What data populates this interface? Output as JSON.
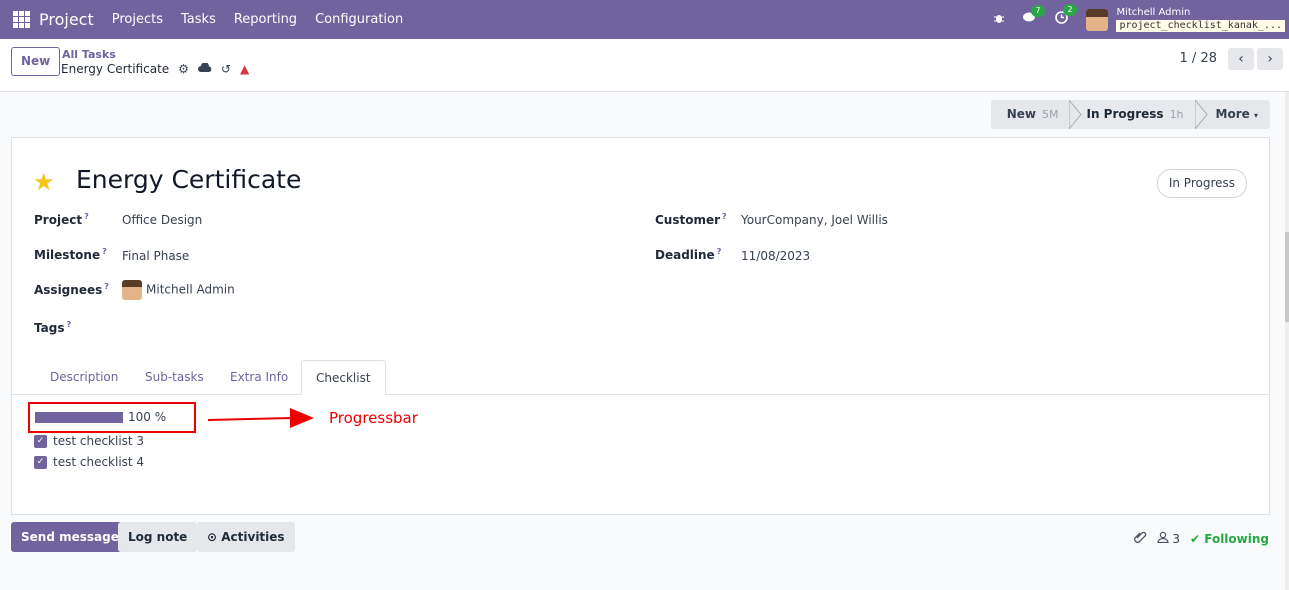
{
  "topnav": {
    "brand": "Project",
    "menu": [
      "Projects",
      "Tasks",
      "Reporting",
      "Configuration"
    ],
    "messages_badge": "7",
    "activities_badge": "2",
    "user_name": "Mitchell Admin",
    "db_name": "project_checklist_kanak_..."
  },
  "control": {
    "new_label": "New",
    "breadcrumb_parent": "All Tasks",
    "breadcrumb_current": "Energy Certificate",
    "pager": "1 / 28"
  },
  "statusbar": [
    {
      "label": "New",
      "time": "5M"
    },
    {
      "label": "In Progress",
      "time": "1h"
    },
    {
      "label": "More"
    }
  ],
  "task": {
    "title": "Energy Certificate",
    "status": "In Progress",
    "project_label": "Project",
    "project": "Office Design",
    "milestone_label": "Milestone",
    "milestone": "Final Phase",
    "assignees_label": "Assignees",
    "assignee": "Mitchell Admin",
    "tags_label": "Tags",
    "customer_label": "Customer",
    "customer": "YourCompany, Joel Willis",
    "deadline_label": "Deadline",
    "deadline": "11/08/2023"
  },
  "tabs": [
    "Description",
    "Sub-tasks",
    "Extra Info",
    "Checklist"
  ],
  "checklist": {
    "progress": 100,
    "progress_text": "100 %",
    "annotation": "Progressbar",
    "items": [
      "test checklist 3",
      "test checklist 4"
    ]
  },
  "chatter": {
    "send_message": "Send message",
    "log_note": "Log note",
    "activities": "Activities",
    "followers": "3",
    "following": "Following"
  },
  "colors": {
    "brand": "#71639e",
    "annotation": "#e00000",
    "following": "#28a745"
  }
}
